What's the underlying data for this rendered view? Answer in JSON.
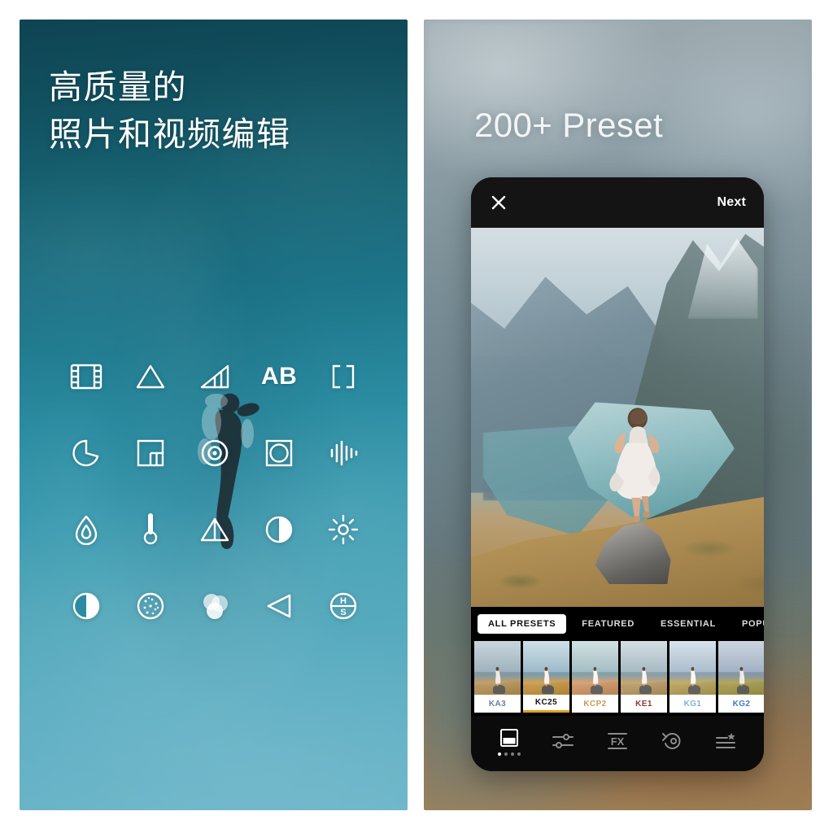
{
  "left_panel": {
    "headline": "高质量的\n照片和视频编辑",
    "background_colors": {
      "top": "#0e4453",
      "middle": "#2b8ca1",
      "bottom": "#6db6c9"
    },
    "tool_icons": [
      {
        "name": "film-strip-icon",
        "label": ""
      },
      {
        "name": "triangle-outline-icon",
        "label": ""
      },
      {
        "name": "signal-bars-icon",
        "label": ""
      },
      {
        "name": "ab-compare-icon",
        "label": "AB"
      },
      {
        "name": "brackets-icon",
        "label": ""
      },
      {
        "name": "clock-crescent-icon",
        "label": ""
      },
      {
        "name": "layout-grid-icon",
        "label": ""
      },
      {
        "name": "target-focus-icon",
        "label": ""
      },
      {
        "name": "crop-rotate-icon",
        "label": ""
      },
      {
        "name": "audio-waveform-icon",
        "label": ""
      },
      {
        "name": "water-drop-flame-icon",
        "label": ""
      },
      {
        "name": "thermometer-icon",
        "label": ""
      },
      {
        "name": "mirror-flip-icon",
        "label": ""
      },
      {
        "name": "contrast-half-icon",
        "label": ""
      },
      {
        "name": "brightness-sun-icon",
        "label": ""
      },
      {
        "name": "contrast-circle-icon",
        "label": ""
      },
      {
        "name": "grain-texture-icon",
        "label": ""
      },
      {
        "name": "color-mixer-icon",
        "label": ""
      },
      {
        "name": "play-left-triangle-icon",
        "label": ""
      },
      {
        "name": "hsl-icon",
        "label": ""
      }
    ]
  },
  "right_panel": {
    "headline": "200+ Preset",
    "background_colors": {
      "top": "#9aa8ad",
      "bottom": "#a08158"
    },
    "phone": {
      "topbar": {
        "close_icon": "close-icon",
        "next_label": "Next"
      },
      "photo": {
        "description": "woman-in-white-dress-on-rock-overlooking-fjord"
      },
      "category_tabs": [
        {
          "label": "ALL PRESETS",
          "active": true
        },
        {
          "label": "FEATURED",
          "active": false
        },
        {
          "label": "ESSENTIAL",
          "active": false
        },
        {
          "label": "POPU",
          "active": false
        }
      ],
      "presets": [
        {
          "label": "KA3",
          "color": "#6d7f96",
          "selected": false
        },
        {
          "label": "KC25",
          "color": "#141414",
          "selected": true
        },
        {
          "label": "KCP2",
          "color": "#c79a5a",
          "selected": false
        },
        {
          "label": "KE1",
          "color": "#8a3b3b",
          "selected": false
        },
        {
          "label": "KG1",
          "color": "#7fb0d8",
          "selected": false
        },
        {
          "label": "KG2",
          "color": "#3f7fc0",
          "selected": false
        }
      ],
      "toolbar": [
        {
          "name": "presets-tool",
          "active": true
        },
        {
          "name": "adjust-tool",
          "active": false
        },
        {
          "name": "fx-tool",
          "active": false
        },
        {
          "name": "history-tool",
          "active": false
        },
        {
          "name": "favorites-tool",
          "active": false
        }
      ]
    }
  }
}
